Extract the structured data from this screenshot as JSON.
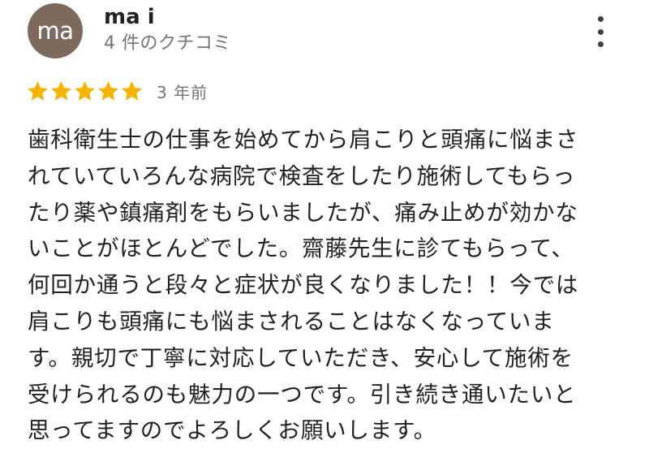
{
  "reviewer": {
    "avatar_text": "ma",
    "avatar_color": "#7d6a5d",
    "name": "ma i",
    "review_count": "4 件のクチコミ"
  },
  "menu": {
    "icon": "more-vert-icon"
  },
  "rating": {
    "stars": 5,
    "max_stars": 5,
    "star_color": "#f4b400",
    "time": "3 年前"
  },
  "review": {
    "text": "歯科衛生士の仕事を始めてから肩こりと頭痛に悩まされていていろんな病院で検査をしたり施術してもらったり薬や鎮痛剤をもらいましたが、痛み止めが効かないことがほとんどでした。齋藤先生に診てもらって、何回か通うと段々と症状が良くなりました！！今では肩こりも頭痛にも悩まされることはなくなっています。親切で丁寧に対応していただき、安心して施術を受けられるのも魅力の一つです。引き続き通いたいと思ってますのでよろしくお願いします。",
    "lines": [
      "歯科衛生士の仕事を始めてから肩こりと頭痛に悩まさ",
      "れていていろんな病院で検査をしたり施術してもらっ",
      "たり薬や鎮痛剤をもらいましたが、痛み止めが効かな",
      "いことがほとんどでした。齋藤先生に診てもらって、",
      "何回か通うと段々と症状が良くなりました！！今では",
      "肩こりも頭痛にも悩まされることはなくなっていま",
      "す。親切で丁寧に対応していただき、安心して施術を",
      "受けられるのも魅力の一つです。引き続き通いたいと",
      "思ってますのでよろしくお願いします。"
    ]
  }
}
